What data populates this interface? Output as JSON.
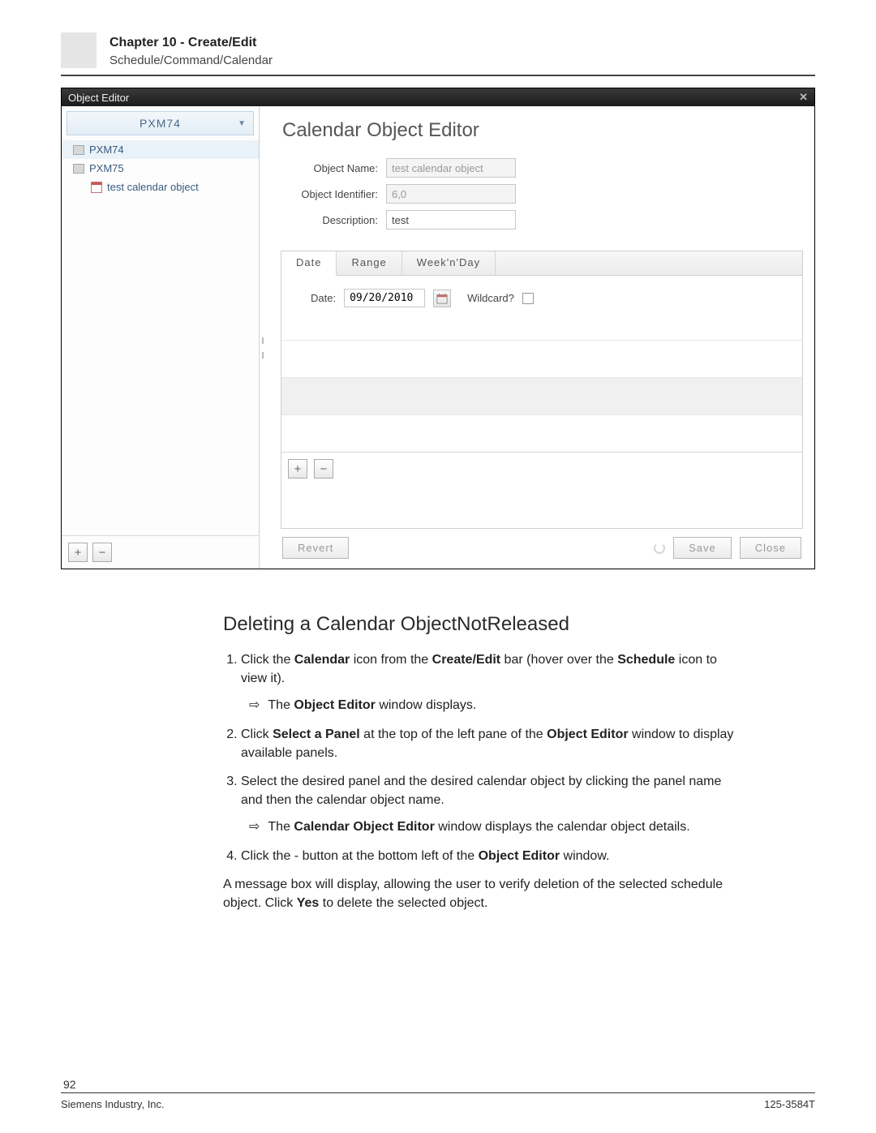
{
  "header": {
    "chapter": "Chapter 10 - Create/Edit",
    "breadcrumb": "Schedule/Command/Calendar"
  },
  "window": {
    "title": "Object Editor"
  },
  "tree": {
    "selector": "PXM74",
    "items": [
      {
        "label": "PXM74"
      },
      {
        "label": "PXM75"
      },
      {
        "label": "test calendar object"
      }
    ],
    "add": "+",
    "remove": "−"
  },
  "editor": {
    "title": "Calendar Object Editor",
    "labels": {
      "objectName": "Object Name:",
      "objectIdentifier": "Object Identifier:",
      "description": "Description:"
    },
    "values": {
      "objectName": "test calendar object",
      "objectIdentifier": "6,0",
      "description": "test"
    },
    "tabs": {
      "date": "Date",
      "range": "Range",
      "weeknday": "Week'n'Day"
    },
    "date": {
      "label": "Date:",
      "value": "09/20/2010",
      "wildcardLabel": "Wildcard?"
    },
    "panel": {
      "add": "+",
      "remove": "−"
    },
    "buttons": {
      "revert": "Revert",
      "save": "Save",
      "close": "Close"
    }
  },
  "doc": {
    "heading": "Deleting a Calendar ObjectNotReleased",
    "step1_a": "Click the ",
    "step1_b": "Calendar",
    "step1_c": " icon from the ",
    "step1_d": "Create/Edit",
    "step1_e": " bar (hover over the ",
    "step1_f": "Schedule",
    "step1_g": " icon to view it).",
    "step1_sub_a": "The ",
    "step1_sub_b": "Object Editor",
    "step1_sub_c": " window displays.",
    "step2_a": "Click ",
    "step2_b": "Select a Panel",
    "step2_c": " at the top of the left pane of the ",
    "step2_d": "Object Editor",
    "step2_e": " window to display available panels.",
    "step3": "Select the desired panel and the desired calendar object by clicking the panel name and then the calendar object name.",
    "step3_sub_a": "The ",
    "step3_sub_b": "Calendar Object Editor",
    "step3_sub_c": " window displays the calendar object details.",
    "step4_a": "Click the - button at the bottom left of the ",
    "step4_b": "Object Editor",
    "step4_c": " window.",
    "trail_a": "A message box will display, allowing the user to verify deletion of the selected schedule object. Click ",
    "trail_b": "Yes",
    "trail_c": " to delete the selected object."
  },
  "footer": {
    "pageNum": "92",
    "left": "Siemens Industry, Inc.",
    "right": "125-3584T"
  }
}
